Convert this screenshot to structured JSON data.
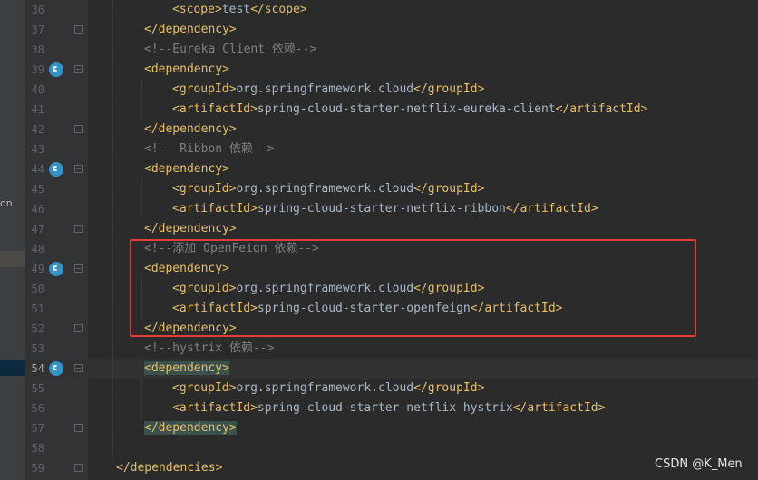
{
  "left_panel": {
    "label": "on"
  },
  "editor": {
    "lines": [
      {
        "n": "36",
        "indent": 3,
        "tokens": [
          {
            "k": "t",
            "s": "<scope>"
          },
          {
            "k": "v",
            "s": "test"
          },
          {
            "k": "t",
            "s": "</scope>"
          }
        ]
      },
      {
        "n": "37",
        "indent": 2,
        "tokens": [
          {
            "k": "t",
            "s": "</dependency>"
          }
        ]
      },
      {
        "n": "38",
        "indent": 2,
        "tokens": [
          {
            "k": "c",
            "s": "<!--Eureka Client 依赖-->"
          }
        ]
      },
      {
        "n": "39",
        "indent": 2,
        "mark": true,
        "tokens": [
          {
            "k": "t",
            "s": "<dependency>"
          }
        ]
      },
      {
        "n": "40",
        "indent": 3,
        "tokens": [
          {
            "k": "t",
            "s": "<groupId>"
          },
          {
            "k": "v",
            "s": "org.springframework.cloud"
          },
          {
            "k": "t",
            "s": "</groupId>"
          }
        ]
      },
      {
        "n": "41",
        "indent": 3,
        "tokens": [
          {
            "k": "t",
            "s": "<artifactId>"
          },
          {
            "k": "v",
            "s": "spring-cloud-starter-netflix-eureka-client"
          },
          {
            "k": "t",
            "s": "</artifactId>"
          }
        ]
      },
      {
        "n": "42",
        "indent": 2,
        "tokens": [
          {
            "k": "t",
            "s": "</dependency>"
          }
        ]
      },
      {
        "n": "43",
        "indent": 2,
        "tokens": [
          {
            "k": "c",
            "s": "<!-- Ribbon 依赖-->"
          }
        ]
      },
      {
        "n": "44",
        "indent": 2,
        "mark": true,
        "tokens": [
          {
            "k": "t",
            "s": "<dependency>"
          }
        ]
      },
      {
        "n": "45",
        "indent": 3,
        "tokens": [
          {
            "k": "t",
            "s": "<groupId>"
          },
          {
            "k": "v",
            "s": "org.springframework.cloud"
          },
          {
            "k": "t",
            "s": "</groupId>"
          }
        ]
      },
      {
        "n": "46",
        "indent": 3,
        "tokens": [
          {
            "k": "t",
            "s": "<artifactId>"
          },
          {
            "k": "v",
            "s": "spring-cloud-starter-netflix-ribbon"
          },
          {
            "k": "t",
            "s": "</artifactId>"
          }
        ]
      },
      {
        "n": "47",
        "indent": 2,
        "tokens": [
          {
            "k": "t",
            "s": "</dependency>"
          }
        ]
      },
      {
        "n": "48",
        "indent": 2,
        "tokens": [
          {
            "k": "c",
            "s": "<!--添加 OpenFeign 依赖-->"
          }
        ]
      },
      {
        "n": "49",
        "indent": 2,
        "mark": true,
        "tokens": [
          {
            "k": "t",
            "s": "<dependency>"
          }
        ]
      },
      {
        "n": "50",
        "indent": 3,
        "tokens": [
          {
            "k": "t",
            "s": "<groupId>"
          },
          {
            "k": "v",
            "s": "org.springframework.cloud"
          },
          {
            "k": "t",
            "s": "</groupId>"
          }
        ]
      },
      {
        "n": "51",
        "indent": 3,
        "tokens": [
          {
            "k": "t",
            "s": "<artifactId>"
          },
          {
            "k": "v",
            "s": "spring-cloud-starter-openfeign"
          },
          {
            "k": "t",
            "s": "</artifactId>"
          }
        ]
      },
      {
        "n": "52",
        "indent": 2,
        "tokens": [
          {
            "k": "t",
            "s": "</dependency>"
          }
        ]
      },
      {
        "n": "53",
        "indent": 2,
        "tokens": [
          {
            "k": "c",
            "s": "<!--hystrix 依赖-->"
          }
        ]
      },
      {
        "n": "54",
        "indent": 2,
        "mark": true,
        "current": true,
        "tokens": [
          {
            "k": "t",
            "s": "<dependency>",
            "hl": true
          }
        ]
      },
      {
        "n": "55",
        "indent": 3,
        "tokens": [
          {
            "k": "t",
            "s": "<groupId>"
          },
          {
            "k": "v",
            "s": "org.springframework.cloud"
          },
          {
            "k": "t",
            "s": "</groupId>"
          }
        ]
      },
      {
        "n": "56",
        "indent": 3,
        "tokens": [
          {
            "k": "t",
            "s": "<artifactId>"
          },
          {
            "k": "v",
            "s": "spring-cloud-starter-netflix-hystrix"
          },
          {
            "k": "t",
            "s": "</artifactId>"
          }
        ]
      },
      {
        "n": "57",
        "indent": 2,
        "tokens": [
          {
            "k": "t",
            "s": "</dependency>",
            "hl": true
          }
        ]
      },
      {
        "n": "58",
        "indent": 0,
        "tokens": []
      },
      {
        "n": "59",
        "indent": 1,
        "tokens": [
          {
            "k": "t",
            "s": "</dependencies>"
          }
        ]
      }
    ]
  },
  "watermark": "CSDN @K_Men",
  "colors": {
    "tag": "#e8bf6a",
    "text": "#a9b7c6",
    "comment": "#808080",
    "highlight_box": "#e63b36"
  }
}
